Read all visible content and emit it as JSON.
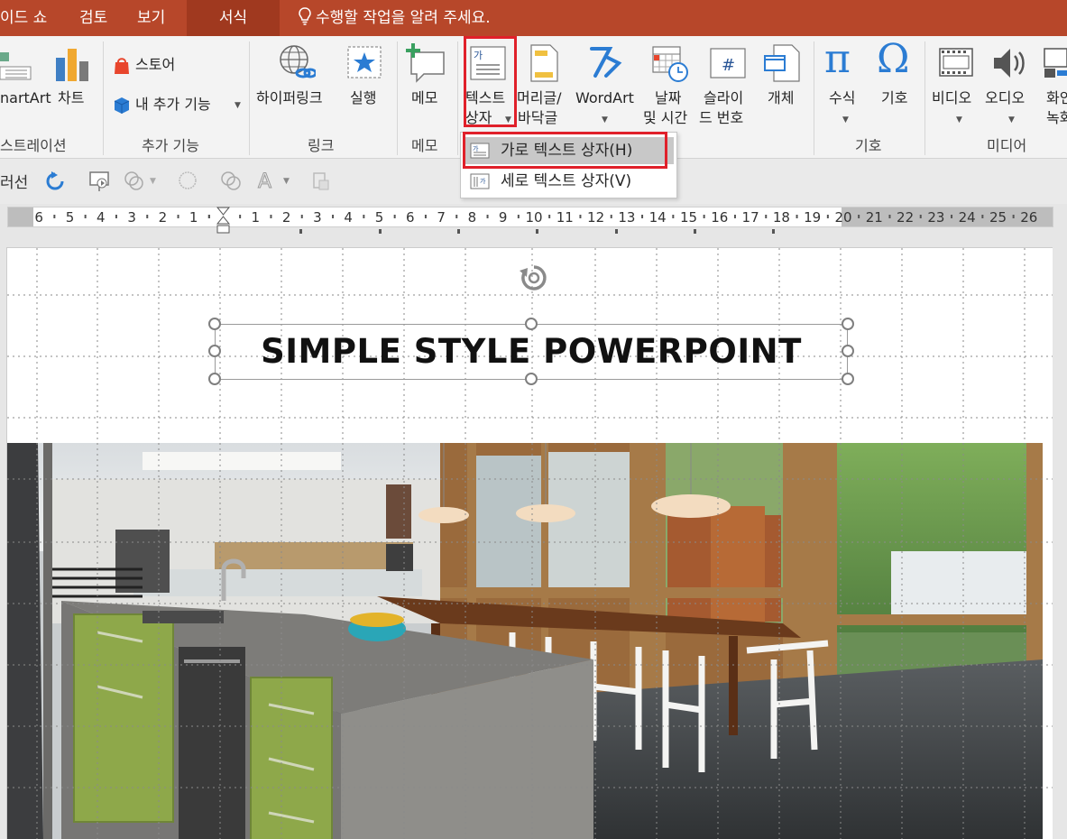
{
  "tabs": [
    {
      "label": "이드 쇼",
      "active": false
    },
    {
      "label": "검토",
      "active": false
    },
    {
      "label": "보기",
      "active": false
    },
    {
      "label": "서식",
      "active": true
    }
  ],
  "tell_me": "수행할 작업을 알려 주세요.",
  "ribbon": {
    "smartart_label": "nartArt",
    "chart_label": "차트",
    "illustration_group": "스트레이션",
    "store_label": "스토어",
    "my_addins_label": "내 추가 기능",
    "addins_group": "추가 기능",
    "hyperlink_label": "하이퍼링크",
    "action_label": "실행",
    "link_group": "링크",
    "memo_label": "메모",
    "memo_group": "메모",
    "textbox_line1": "텍스트",
    "textbox_line2": "상자",
    "header_line1": "머리글/",
    "header_line2": "바닥글",
    "wordart_label": "WordArt",
    "datetime_line1": "날짜",
    "datetime_line2": "및 시간",
    "slideno_line1": "슬라이",
    "slideno_line2": "드 번호",
    "object_label": "개체",
    "equation_label": "수식",
    "symbol_label": "기호",
    "symbols_group": "기호",
    "video_label": "비디오",
    "audio_label": "오디오",
    "screen_line1": "화인",
    "screen_line2": "녹화",
    "media_group": "미디어"
  },
  "dropdown": {
    "horizontal_textbox": "가로 텍스트 상자(H)",
    "vertical_textbox": "세로 텍스트 상자(V)"
  },
  "toolbar2": {
    "partial_label": "러선"
  },
  "ruler": {
    "left_labels": [
      "6",
      "5",
      "4",
      "3",
      "2",
      "1"
    ],
    "right_labels": [
      "1",
      "2",
      "3",
      "4",
      "5",
      "6",
      "7",
      "8",
      "9",
      "10",
      "11",
      "12",
      "13",
      "14",
      "15",
      "16",
      "17",
      "18",
      "19",
      "20",
      "21",
      "22",
      "23",
      "24",
      "25",
      "26"
    ]
  },
  "slide": {
    "title": "SIMPLE STYLE POWERPOINT"
  },
  "colors": {
    "accent": "#b7472a",
    "highlight_box": "#e0202a"
  }
}
